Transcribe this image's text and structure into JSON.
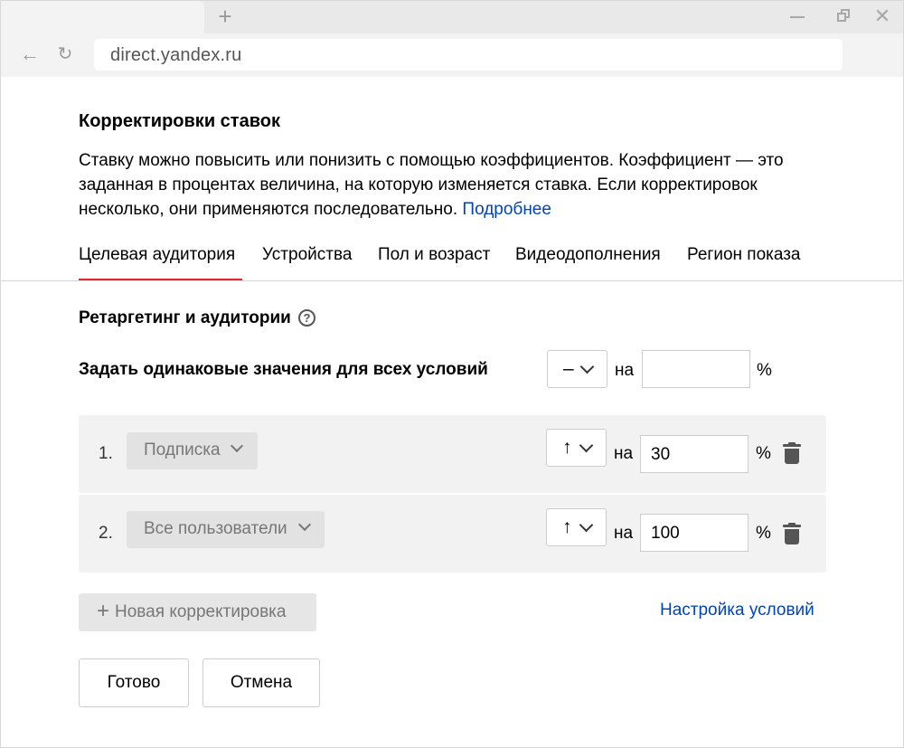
{
  "browser": {
    "url": "direct.yandex.ru",
    "icons": {
      "new_tab": "plus-icon",
      "minimize": "minimize-icon",
      "restore": "restore-icon",
      "close": "close-icon",
      "back": "arrow-left-icon",
      "reload": "reload-icon"
    }
  },
  "dialog": {
    "title": "Корректировки ставок",
    "description": "Ставку можно повысить или понизить с помощью коэффициентов. Коэффициент — это заданная в процентах величина, на которую изменяется ставка. Если корректировок несколько, они применяются последовательно.",
    "more_link": "Подробнее",
    "tabs": [
      {
        "label": "Целевая аудитория",
        "active": true
      },
      {
        "label": "Устройства",
        "active": false
      },
      {
        "label": "Пол и возраст",
        "active": false
      },
      {
        "label": "Видеодополнения",
        "active": false
      },
      {
        "label": "Регион показа",
        "active": false
      }
    ],
    "section_title": "Ретаргетинг и аудитории",
    "help_icon": "?",
    "common": {
      "label": "Задать одинаковые значения для всех условий",
      "direction": "–",
      "on_label": "на",
      "value": "",
      "percent": "%"
    },
    "rows": [
      {
        "number": "1.",
        "audience": "Подписка",
        "direction": "↑",
        "on_label": "на",
        "value": "30",
        "percent": "%"
      },
      {
        "number": "2.",
        "audience": "Все пользователи",
        "direction": "↑",
        "on_label": "на",
        "value": "100",
        "percent": "%"
      }
    ],
    "add_button": {
      "plus": "+",
      "label": "Новая корректировка"
    },
    "settings_link": "Настройка условий",
    "done_button": "Готово",
    "cancel_button": "Отмена"
  },
  "colors": {
    "accent_red": "#e3292c",
    "link_blue": "#0044bb"
  }
}
